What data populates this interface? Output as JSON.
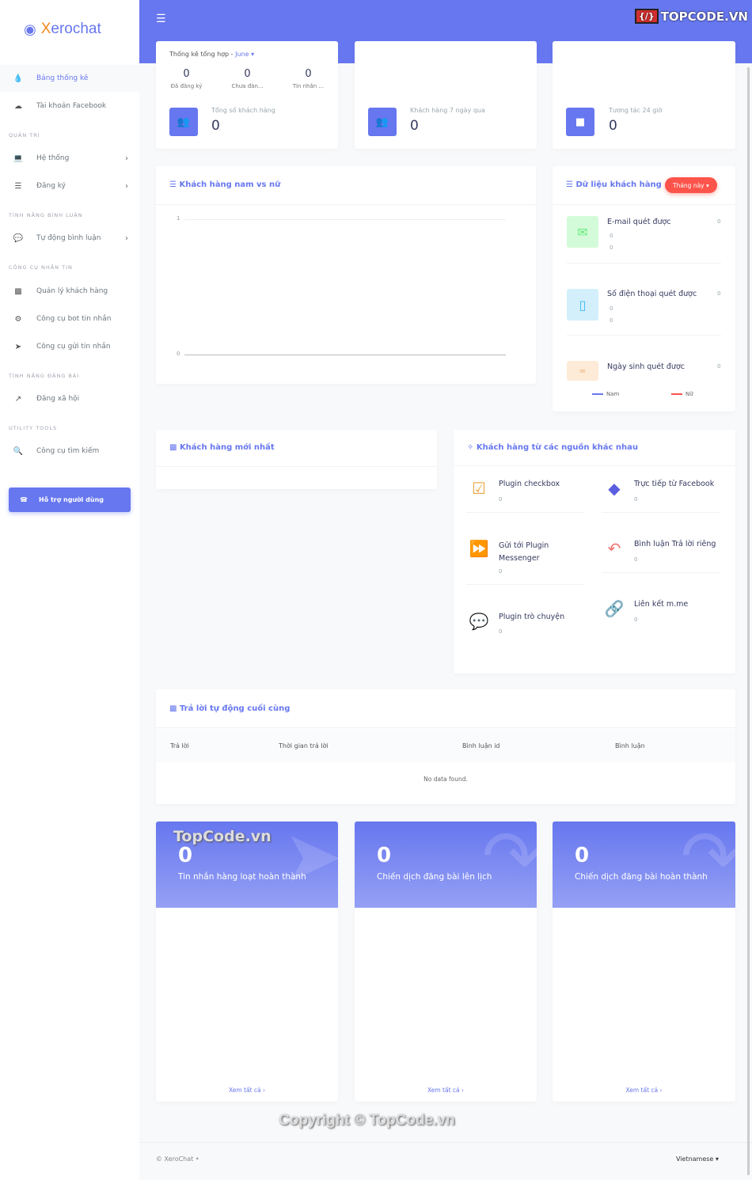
{
  "brand": {
    "name": "XeroChat",
    "watermark_logo": "TOPCODE.VN"
  },
  "sidebar": {
    "items": [
      {
        "label": "Bảng thống kê",
        "icon": "fire-icon",
        "active": true
      },
      {
        "label": "Tài khoản Facebook",
        "icon": "cloud-download-icon"
      },
      {
        "label": "Hệ thống",
        "icon": "laptop-icon",
        "chevron": true
      },
      {
        "label": "Đăng ký",
        "icon": "coins-icon",
        "chevron": true
      },
      {
        "label": "Tự động bình luận",
        "icon": "comments-icon",
        "chevron": true
      },
      {
        "label": "Quản lý khách hàng",
        "icon": "address-book-icon"
      },
      {
        "label": "Công cụ bot tin nhắn",
        "icon": "robot-icon"
      },
      {
        "label": "Công cụ gửi tin nhắn",
        "icon": "paper-plane-icon"
      },
      {
        "label": "Đăng xã hội",
        "icon": "share-icon"
      },
      {
        "label": "Công cụ tìm kiếm",
        "icon": "search-icon"
      }
    ],
    "sections": [
      "QUẢN TRỊ",
      "TÍNH NĂNG BÌNH LUẬN",
      "CÔNG CỤ NHẮN TIN",
      "TÍNH NĂNG ĐĂNG BÀI",
      "UTILITY TOOLS"
    ],
    "support_label": "Hỗ trợ người dùng"
  },
  "summary": {
    "title": "Thống kê tổng hợp -",
    "month": "June",
    "stats": [
      {
        "value": "0",
        "label": "Đã đăng ký"
      },
      {
        "value": "0",
        "label": "Chưa đăn..."
      },
      {
        "value": "0",
        "label": "Tin nhắn ..."
      }
    ],
    "total_label": "Tổng số khách hàng",
    "total_value": "0"
  },
  "week": {
    "label": "Khách hàng 7 ngày qua",
    "value": "0"
  },
  "interaction": {
    "label": "Tương tác 24 giờ",
    "value": "0"
  },
  "gender_chart": {
    "title": "Khách hàng nam vs nữ",
    "y_ticks": [
      "1",
      "0"
    ],
    "legend": [
      "Nam",
      "Nữ"
    ],
    "colors": {
      "Nam": "#6777ef",
      "Nữ": "#fc544b"
    }
  },
  "customer_data": {
    "title": "Dữ liệu khách hàng",
    "filter": "Tháng này",
    "items": [
      {
        "label": "E-mail quét được",
        "count": "0",
        "a": "0",
        "b": "0",
        "icon": "envelope-icon"
      },
      {
        "label": "Số điện thoại quét được",
        "count": "0",
        "a": "0",
        "b": "0",
        "icon": "mobile-icon"
      },
      {
        "label": "Ngày sinh quét được",
        "count": "0",
        "icon": "birthday-cake-icon"
      }
    ]
  },
  "newest": {
    "title": "Khách hàng mới nhất"
  },
  "sources": {
    "title": "Khách hàng từ các nguồn khác nhau",
    "items": [
      {
        "label": "Plugin checkbox",
        "value": "0",
        "icon": "checkbox-icon"
      },
      {
        "label": "Trực tiếp từ Facebook",
        "value": "0",
        "icon": "direction-icon"
      },
      {
        "label": "Gửi tới Plugin Messenger",
        "value": "0",
        "icon": "forward-icon"
      },
      {
        "label": "Bình luận Trả lời riêng",
        "value": "0",
        "icon": "reply-all-icon"
      },
      {
        "label": "Plugin trò chuyện",
        "value": "0",
        "icon": "wechat-icon"
      },
      {
        "label": "Liên kết m.me",
        "value": "0",
        "icon": "link-icon"
      }
    ]
  },
  "auto_reply": {
    "title": "Trả lời tự động cuối cùng",
    "columns": [
      "Trả lời",
      "Thời gian trả lời",
      "Bình luận id",
      "Bình luận"
    ],
    "empty": "No data found."
  },
  "bottom_cards": [
    {
      "value": "0",
      "label": "Tin nhắn hàng loạt hoàn thành",
      "more": "Xem tất cả"
    },
    {
      "value": "0",
      "label": "Chiến dịch đăng bài lên lịch",
      "more": "Xem tất cả"
    },
    {
      "value": "0",
      "label": "Chiến dịch đăng bài hoàn thành",
      "more": "Xem tất cả"
    }
  ],
  "watermarks": {
    "card": "TopCode.vn",
    "copyright": "Copyright © TopCode.vn"
  },
  "footer": {
    "copyright": "© XeroChat",
    "language": "Vietnamese"
  }
}
